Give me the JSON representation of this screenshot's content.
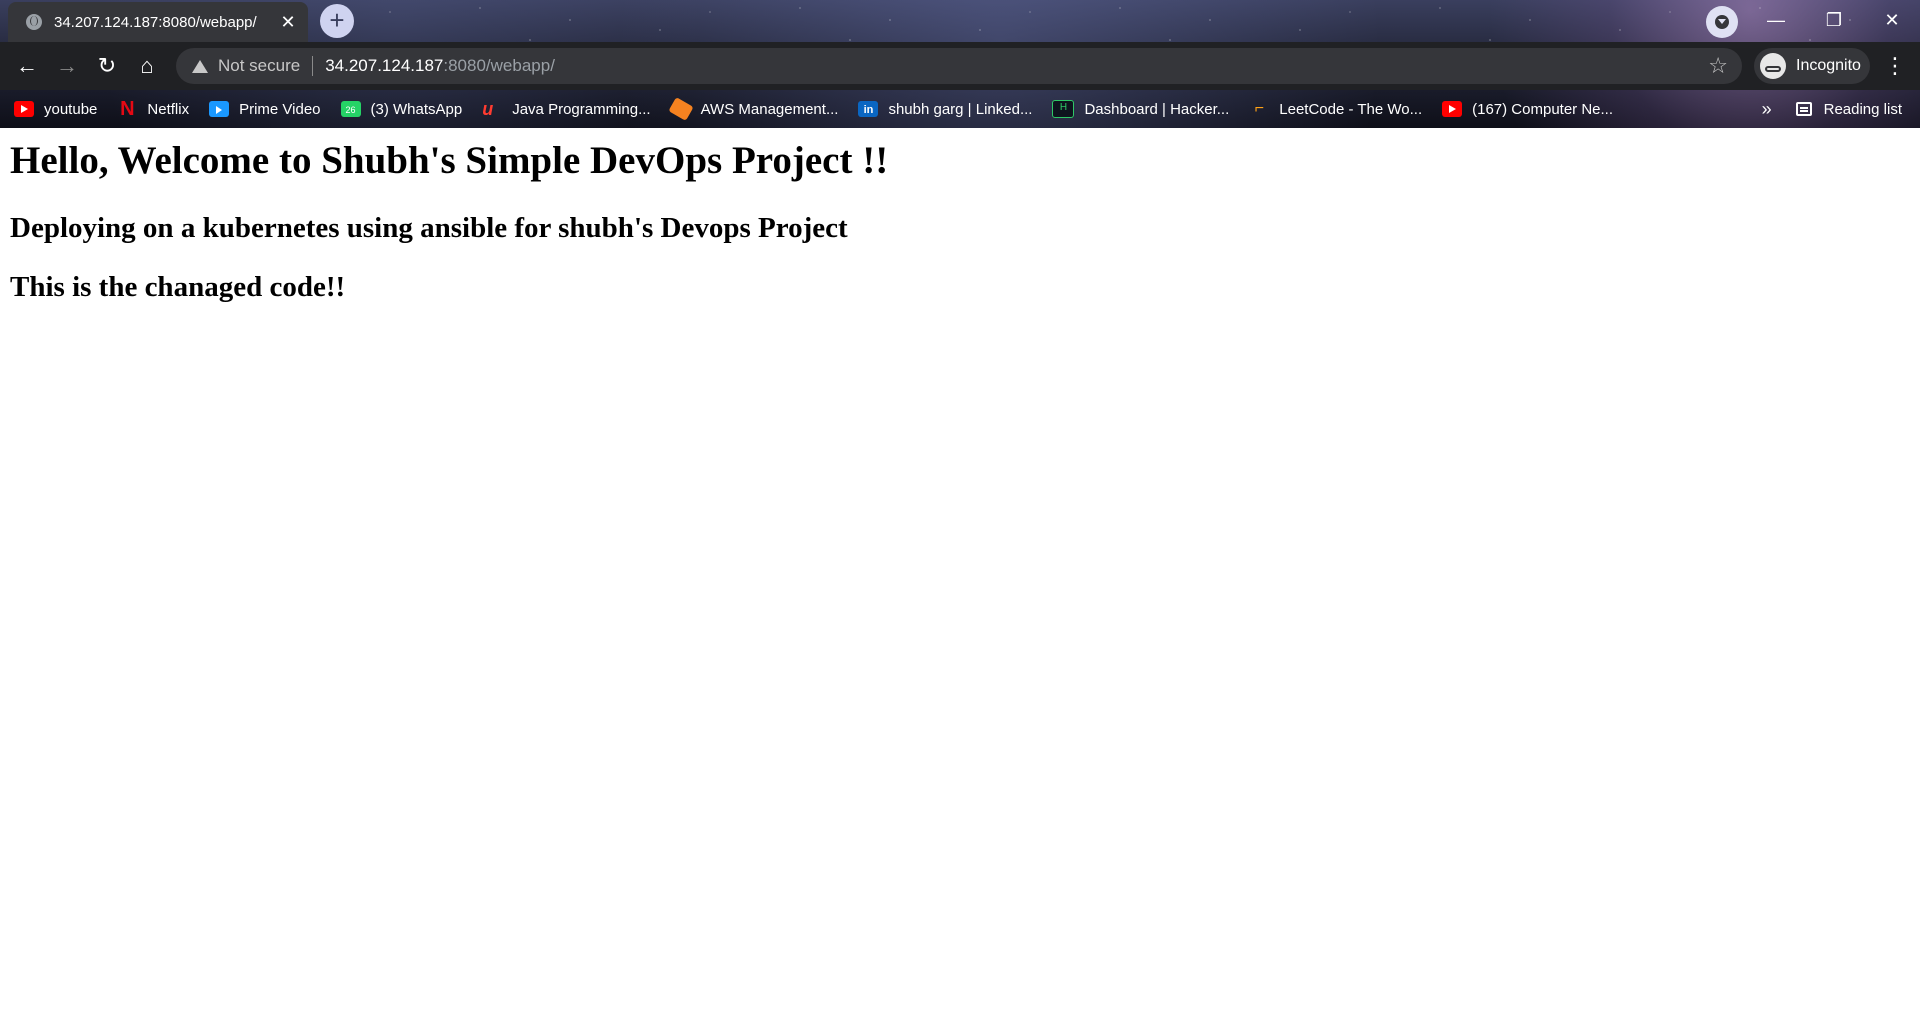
{
  "browser": {
    "tab_title": "34.207.124.187:8080/webapp/",
    "tab_close": "✕",
    "new_tab": "+",
    "window_controls": {
      "minimize": "—",
      "maximize": "❐",
      "close": "✕"
    },
    "toolbar": {
      "back": "←",
      "forward": "→",
      "reload": "↻",
      "home": "⌂",
      "security_label": "Not secure",
      "url_host": "34.207.124.187",
      "url_path": ":8080/webapp/",
      "star": "☆",
      "profile_label": "Incognito",
      "menu": "⋮"
    },
    "bookmarks": [
      {
        "label": "youtube",
        "icon": "youtube-icon"
      },
      {
        "label": "Netflix",
        "icon": "netflix-icon",
        "glyph": "N"
      },
      {
        "label": "Prime Video",
        "icon": "prime-video-icon"
      },
      {
        "label": "(3) WhatsApp",
        "icon": "whatsapp-icon",
        "glyph": "26"
      },
      {
        "label": "Java Programming...",
        "icon": "java-icon",
        "glyph": "u"
      },
      {
        "label": "AWS Management...",
        "icon": "aws-icon"
      },
      {
        "label": "shubh garg | Linked...",
        "icon": "linkedin-icon",
        "glyph": "in"
      },
      {
        "label": "Dashboard | Hacker...",
        "icon": "hackerrank-icon",
        "glyph": "H"
      },
      {
        "label": "LeetCode - The Wo...",
        "icon": "leetcode-icon",
        "glyph": "⌐"
      },
      {
        "label": "(167) Computer Ne...",
        "icon": "youtube-icon"
      }
    ],
    "bookmarks_overflow": "»",
    "reading_list": "Reading list"
  },
  "page": {
    "heading": "Hello, Welcome to Shubh's Simple DevOps Project !!",
    "subheading_1": "Deploying on a kubernetes using ansible for shubh's Devops Project",
    "subheading_2": "This is the chanaged code!!"
  },
  "colors": {
    "toolbar_bg": "#202124",
    "omnibox_bg": "#35363a",
    "page_bg": "#ffffff",
    "text": "#000000"
  }
}
